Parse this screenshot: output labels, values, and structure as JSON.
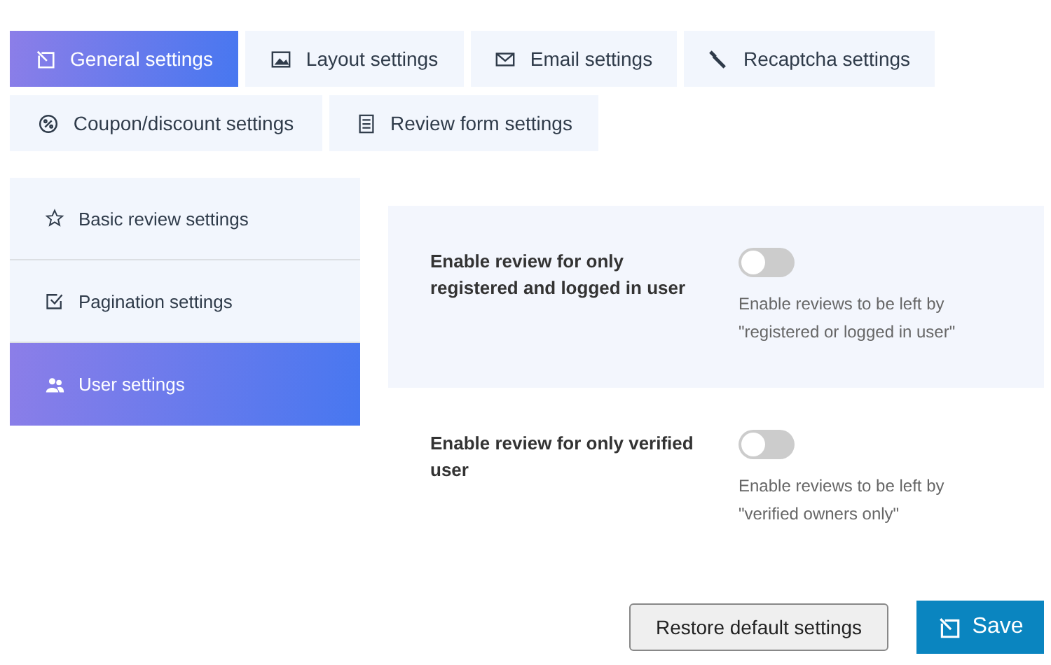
{
  "tabs": [
    {
      "label": "General settings",
      "selected": true
    },
    {
      "label": "Layout settings",
      "selected": false
    },
    {
      "label": "Email settings",
      "selected": false
    },
    {
      "label": "Recaptcha settings",
      "selected": false
    },
    {
      "label": "Coupon/discount settings",
      "selected": false
    },
    {
      "label": "Review form settings",
      "selected": false
    }
  ],
  "sidebar": {
    "items": [
      {
        "label": "Basic review settings",
        "selected": false
      },
      {
        "label": "Pagination settings",
        "selected": false
      },
      {
        "label": "User settings",
        "selected": true
      }
    ]
  },
  "settings": [
    {
      "label": "Enable review for only registered and logged in user",
      "on": false,
      "description": "Enable reviews to be left by \"registered or logged in user\""
    },
    {
      "label": "Enable review for only verified user",
      "on": false,
      "description": "Enable reviews to be left by \"verified owners only\""
    }
  ],
  "buttons": {
    "restore": "Restore default settings",
    "save": "Save"
  }
}
